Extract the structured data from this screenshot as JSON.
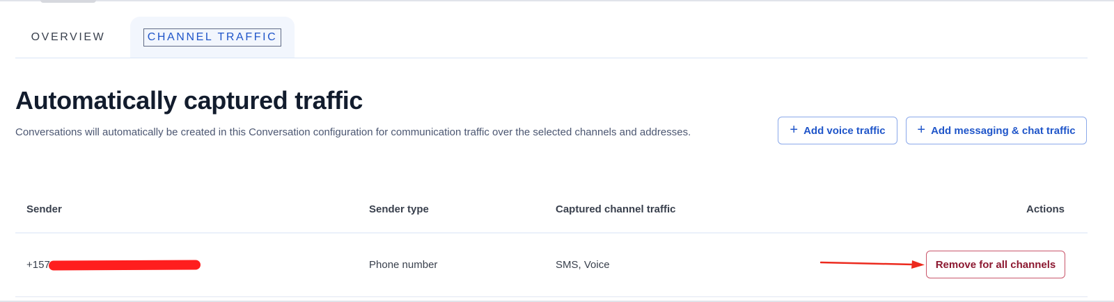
{
  "tabs": {
    "overview": "OVERVIEW",
    "channel_traffic": "CHANNEL TRAFFIC",
    "active": "channel_traffic"
  },
  "page": {
    "title": "Automatically captured traffic",
    "description": "Conversations will automatically be created in this Conversation configuration for communication traffic over the selected channels and addresses."
  },
  "actions": {
    "add_voice": "Add voice traffic",
    "add_messaging": "Add messaging & chat traffic"
  },
  "table": {
    "columns": {
      "sender": "Sender",
      "sender_type": "Sender type",
      "captured": "Captured channel traffic",
      "actions": "Actions"
    },
    "rows": [
      {
        "sender": "+157",
        "sender_type": "Phone number",
        "captured": "SMS, Voice",
        "action": "Remove for all channels"
      }
    ]
  },
  "icons": {
    "plus": "plus-icon",
    "annotation": "red-arrow-annotation"
  },
  "colors": {
    "brand_blue": "#1f55c9",
    "destructive": "#8c1830",
    "annotation_red": "#ff1e1e"
  }
}
